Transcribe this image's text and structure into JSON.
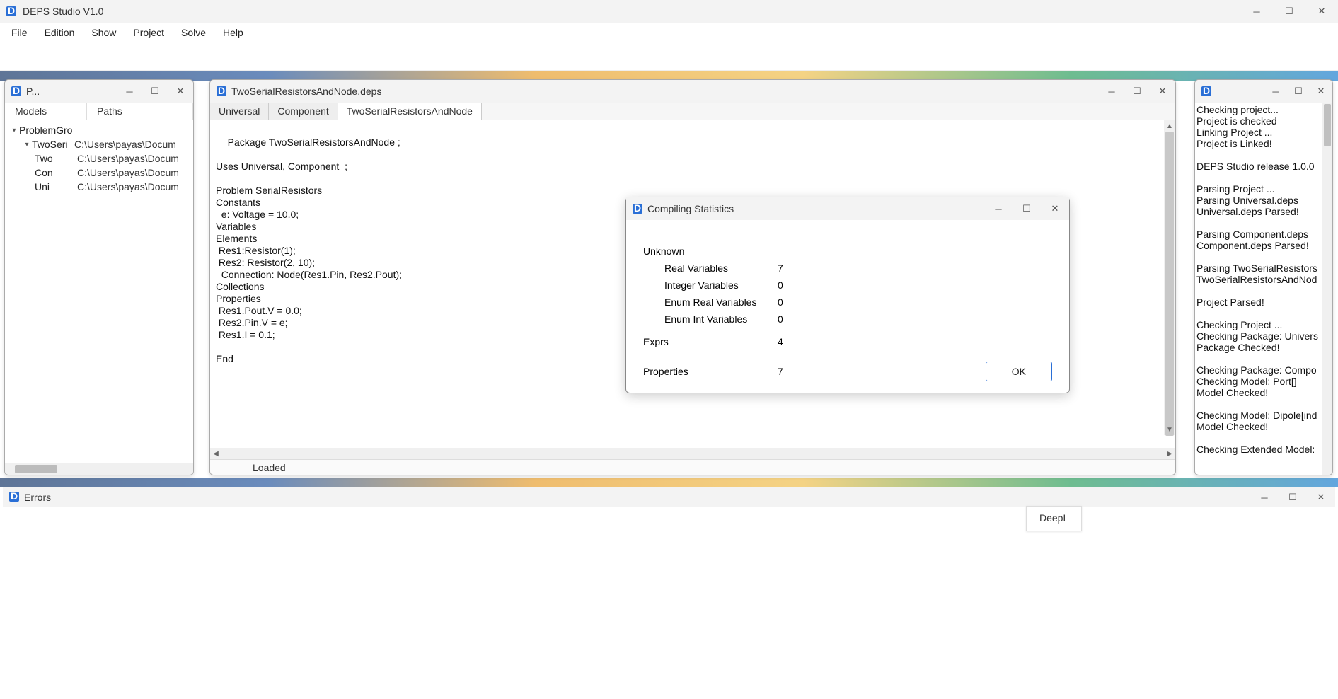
{
  "main_window": {
    "title": "DEPS Studio V1.0"
  },
  "menu": {
    "file": "File",
    "edition": "Edition",
    "show": "Show",
    "project": "Project",
    "solve": "Solve",
    "help": "Help"
  },
  "project_panel": {
    "title": "P...",
    "tabs": {
      "models": "Models",
      "paths": "Paths"
    },
    "tree": {
      "root": "ProblemGro",
      "items": [
        {
          "label": "TwoSeri",
          "path": "C:\\Users\\payas\\Docum"
        },
        {
          "label": "Two",
          "path": "C:\\Users\\payas\\Docum"
        },
        {
          "label": "Con",
          "path": "C:\\Users\\payas\\Docum"
        },
        {
          "label": "Uni",
          "path": "C:\\Users\\payas\\Docum"
        }
      ]
    }
  },
  "editor": {
    "title": "TwoSerialResistorsAndNode.deps",
    "tabs": [
      {
        "label": "Universal",
        "active": false
      },
      {
        "label": "Component",
        "active": false
      },
      {
        "label": "TwoSerialResistorsAndNode",
        "active": true
      }
    ],
    "code_lines": [
      "Package TwoSerialResistorsAndNode ;",
      "",
      "Uses Universal, Component  ;",
      "",
      "Problem SerialResistors",
      "Constants",
      "  e: Voltage = 10.0;",
      "Variables",
      "Elements",
      " Res1:Resistor(1);",
      " Res2: Resistor(2, 10);",
      "  Connection: Node(Res1.Pin, Res2.Pout);",
      "Collections",
      "Properties",
      " Res1.Pout.V = 0.0;",
      " Res2.Pin.V = e;",
      " Res1.I = 0.1;",
      "",
      "End"
    ],
    "status": "Loaded"
  },
  "compiling_dialog": {
    "title": "Compiling Statistics",
    "unknown_label": "Unknown",
    "rows": [
      {
        "label": "Real Variables",
        "value": "7"
      },
      {
        "label": "Integer Variables",
        "value": "0"
      },
      {
        "label": "Enum Real Variables",
        "value": "0"
      },
      {
        "label": "Enum Int Variables",
        "value": "0"
      }
    ],
    "exprs_label": "Exprs",
    "exprs_value": "4",
    "props_label": "Properties",
    "props_value": "7",
    "ok": "OK"
  },
  "log_panel": {
    "title": "",
    "lines": [
      "Checking project...",
      "Project is checked",
      "Linking Project ...",
      "Project is Linked!",
      "",
      "DEPS Studio release 1.0.0",
      "",
      "Parsing Project ...",
      "Parsing Universal.deps",
      "Universal.deps Parsed!",
      "",
      "Parsing Component.deps",
      "Component.deps Parsed!",
      "",
      "Parsing TwoSerialResistors",
      "TwoSerialResistorsAndNod",
      "",
      "Project Parsed!",
      "",
      "Checking Project ...",
      "Checking Package: Univers",
      "Package Checked!",
      "",
      "Checking Package: Compo",
      "Checking Model: Port[]",
      "Model Checked!",
      "",
      "Checking Model: Dipole[ind",
      "Model Checked!",
      "",
      "Checking Extended Model:"
    ]
  },
  "errors_window": {
    "title": "Errors"
  },
  "deepl": {
    "label": "DeepL"
  }
}
